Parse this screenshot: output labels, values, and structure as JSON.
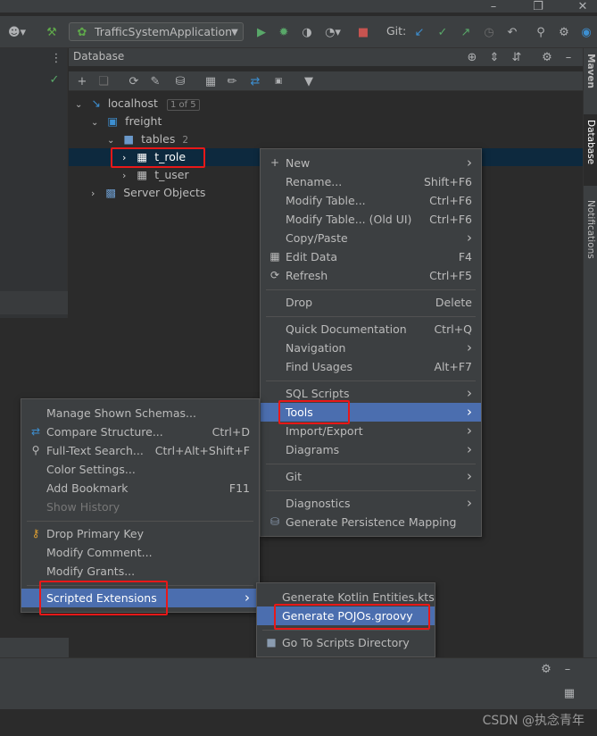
{
  "toolbar": {
    "run_config": "TrafficSystemApplication",
    "git_label": "Git:"
  },
  "db_panel": {
    "title": "Database"
  },
  "side_tabs": {
    "maven": "Maven",
    "database": "Database",
    "notifications": "Notifications"
  },
  "tree": {
    "host": "localhost",
    "host_badge": "1 of 5",
    "schema": "freight",
    "folder": "tables",
    "folder_count": "2",
    "table1": "t_role",
    "table2": "t_user",
    "server_objects": "Server Objects"
  },
  "context_menu": {
    "items": [
      {
        "label": "New",
        "shortcut": "",
        "submenu": true,
        "icon": "plus-icon"
      },
      {
        "label": "Rename...",
        "shortcut": "Shift+F6"
      },
      {
        "label": "Modify Table...",
        "shortcut": "Ctrl+F6"
      },
      {
        "label": "Modify Table... (Old UI)",
        "shortcut": "Ctrl+F6"
      },
      {
        "label": "Copy/Paste",
        "shortcut": "",
        "submenu": true
      },
      {
        "label": "Edit Data",
        "shortcut": "F4",
        "icon": "table-grid-icon"
      },
      {
        "label": "Refresh",
        "shortcut": "Ctrl+F5",
        "icon": "refresh-icon"
      },
      {
        "label": "Drop",
        "shortcut": "Delete"
      },
      {
        "label": "Quick Documentation",
        "shortcut": "Ctrl+Q"
      },
      {
        "label": "Navigation",
        "shortcut": "",
        "submenu": true
      },
      {
        "label": "Find Usages",
        "shortcut": "Alt+F7"
      },
      {
        "label": "SQL Scripts",
        "shortcut": "",
        "submenu": true
      },
      {
        "label": "Tools",
        "shortcut": "",
        "submenu": true
      },
      {
        "label": "Import/Export",
        "shortcut": "",
        "submenu": true
      },
      {
        "label": "Diagrams",
        "shortcut": "",
        "submenu": true
      },
      {
        "label": "Git",
        "shortcut": "",
        "submenu": true
      },
      {
        "label": "Diagnostics",
        "shortcut": "",
        "submenu": true
      },
      {
        "label": "Generate Persistence Mapping",
        "shortcut": "",
        "icon": "persistence-icon"
      }
    ]
  },
  "tools_menu": {
    "items": [
      {
        "label": "Manage Shown Schemas...",
        "shortcut": ""
      },
      {
        "label": "Compare Structure...",
        "shortcut": "Ctrl+D",
        "icon": "compare-icon"
      },
      {
        "label": "Full-Text Search...",
        "shortcut": "Ctrl+Alt+Shift+F",
        "icon": "search-icon"
      },
      {
        "label": "Color Settings...",
        "shortcut": ""
      },
      {
        "label": "Add Bookmark",
        "shortcut": "F11"
      },
      {
        "label": "Show History",
        "shortcut": "",
        "disabled": true
      },
      {
        "label": "Drop Primary Key",
        "shortcut": "",
        "icon": "key-icon"
      },
      {
        "label": "Modify Comment...",
        "shortcut": ""
      },
      {
        "label": "Modify Grants...",
        "shortcut": ""
      },
      {
        "label": "Scripted Extensions",
        "shortcut": "",
        "submenu": true
      }
    ]
  },
  "scripts_menu": {
    "items": [
      {
        "label": "Generate Kotlin Entities.kts"
      },
      {
        "label": "Generate POJOs.groovy"
      },
      {
        "label": "Go To Scripts Directory",
        "icon": "folder-icon"
      }
    ]
  },
  "watermark": "CSDN @执念青年",
  "colors": {
    "highlight": "#4b6eaf",
    "annotation": "#e81818",
    "menu_bg": "#3c3f41",
    "panel_bg": "#2b2b2b"
  }
}
